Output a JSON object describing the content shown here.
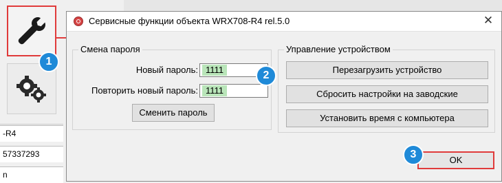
{
  "background": {
    "cells": [
      "-R4",
      "57337293",
      "n"
    ]
  },
  "dialog": {
    "title": "Сервисные функции объекта WRX708-R4 rel.5.0",
    "close_label": "✕",
    "password_group": {
      "title": "Смена пароля",
      "new_password_label": "Новый пароль:",
      "new_password_value": "1111",
      "repeat_password_label": "Повторить новый пароль:",
      "repeat_password_value": "1111",
      "change_button": "Сменить пароль"
    },
    "device_group": {
      "title": "Управление устройством",
      "reboot_button": "Перезагрузить устройство",
      "factory_reset_button": "Сбросить настройки на заводские",
      "set_time_button": "Установить время с компьютера"
    },
    "ok_button": "OK"
  },
  "markers": [
    "1",
    "2",
    "3"
  ],
  "colors": {
    "highlight_red": "#e03a3a",
    "marker_blue": "#1f8ad8",
    "field_value_green": "#b9e5b9"
  }
}
